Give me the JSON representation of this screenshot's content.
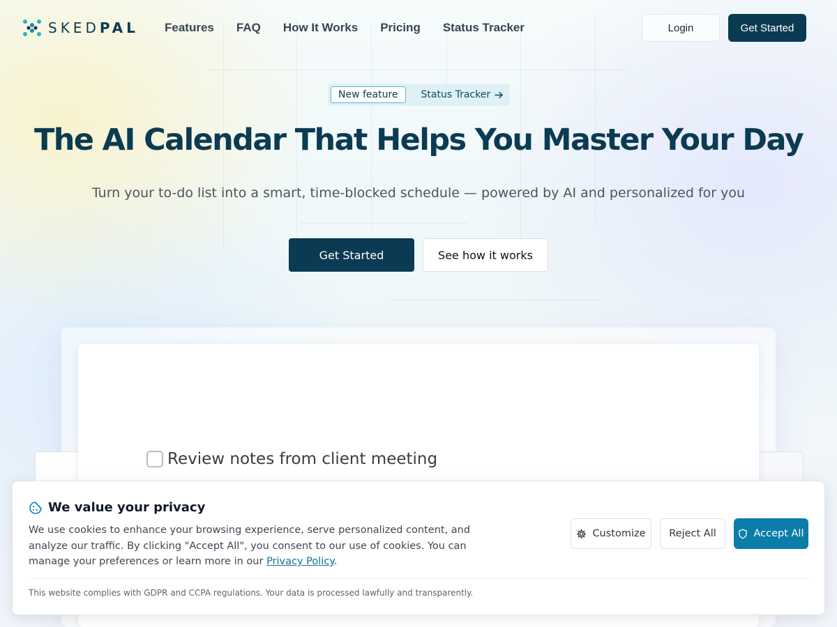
{
  "brand": {
    "name_light": "SKED",
    "name_bold": "PAL",
    "logo_icon": "skedpal-logo-icon",
    "primary_color": "#0b3b52",
    "accent_color": "#0a7ea8"
  },
  "nav": {
    "items": [
      {
        "label": "Features"
      },
      {
        "label": "FAQ"
      },
      {
        "label": "How It Works"
      },
      {
        "label": "Pricing"
      },
      {
        "label": "Status Tracker"
      }
    ],
    "login_label": "Login",
    "get_started_label": "Get Started"
  },
  "hero": {
    "pill_tag": "New feature",
    "pill_link": "Status Tracker",
    "pill_icon": "arrow-right-icon",
    "title": "The AI Calendar That Helps You Master Your Day",
    "subtitle": "Turn your to-do list into a smart, time-blocked schedule — powered by AI and personalized for you",
    "primary_cta": "Get Started",
    "secondary_cta": "See how it works"
  },
  "preview": {
    "task_label": "Review notes from client meeting",
    "task_checked": false
  },
  "cookie_banner": {
    "icon": "cookie-icon",
    "title": "We value your privacy",
    "text_before_link": "We use cookies to enhance your browsing experience, serve personalized content, and analyze our traffic. By clicking \"Accept All\", you consent to our use of cookies. You can manage your preferences or learn more in our ",
    "link_label": "Privacy Policy",
    "text_after_link": ".",
    "customize_label": "Customize",
    "customize_icon": "gear-icon",
    "reject_label": "Reject All",
    "accept_label": "Accept All",
    "accept_icon": "shield-icon",
    "footer": "This website complies with GDPR and CCPA regulations. Your data is processed lawfully and transparently."
  }
}
